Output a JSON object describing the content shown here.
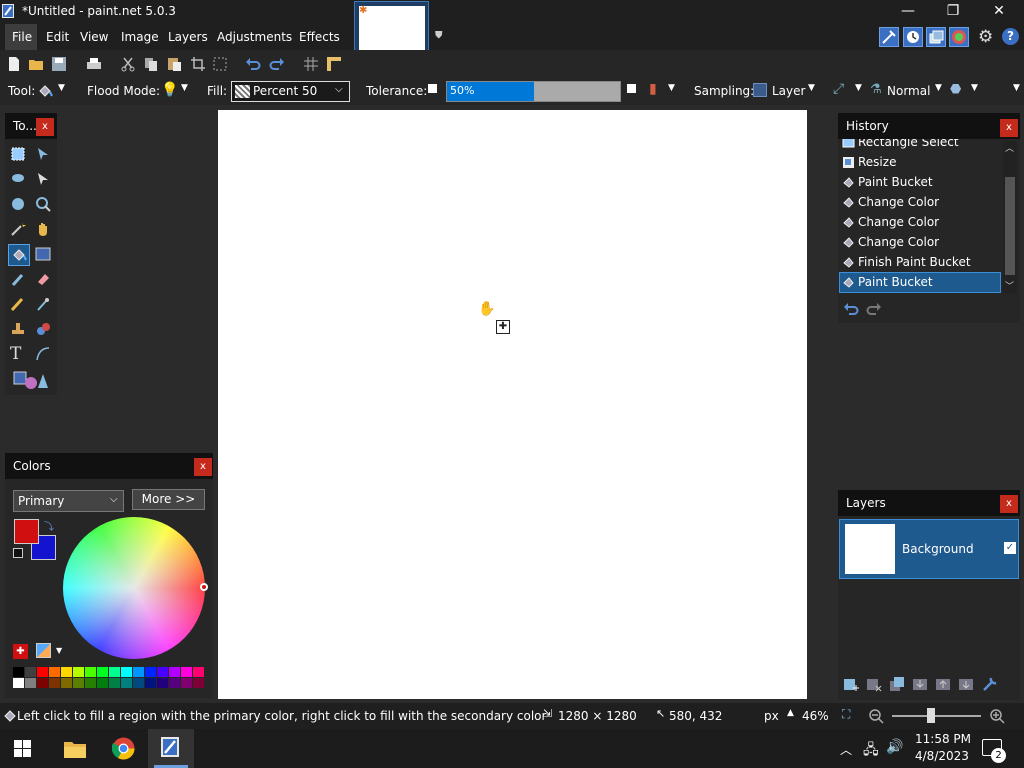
{
  "window": {
    "title": "*Untitled - paint.net 5.0.3",
    "minimize": "—",
    "restore": "❐",
    "close": "✕"
  },
  "menu": [
    "File",
    "Edit",
    "View",
    "Image",
    "Layers",
    "Adjustments",
    "Effects"
  ],
  "toolbar": {
    "tool_label": "Tool:",
    "flood_mode_label": "Flood Mode:",
    "fill_label": "Fill:",
    "fill_value": "Percent 50",
    "tolerance_label": "Tolerance:",
    "tolerance_value": "50%",
    "tolerance_fraction": 0.5,
    "sampling_label": "Sampling:",
    "sampling_value": "Layer",
    "blend_value": "Normal"
  },
  "tools_panel": {
    "title": "To...",
    "close": "x"
  },
  "colors_panel": {
    "title": "Colors",
    "close": "x",
    "mode": "Primary",
    "more_button": "More >>",
    "primary_color": "#d01010",
    "secondary_color": "#1414d0"
  },
  "history_panel": {
    "title": "History",
    "close": "x",
    "items": [
      "Rectangle Select",
      "Resize",
      "Paint Bucket",
      "Change Color",
      "Change Color",
      "Change Color",
      "Finish Paint Bucket",
      "Paint Bucket"
    ],
    "selected_index": 7
  },
  "layers_panel": {
    "title": "Layers",
    "close": "x",
    "layer_name": "Background"
  },
  "status": {
    "hint": "Left click to fill a region with the primary color, right click to fill with the secondary color",
    "image_size": "1280 × 1280",
    "cursor_pos": "580, 432",
    "units": "px",
    "zoom": "46%"
  },
  "taskbar": {
    "time": "11:58 PM",
    "date": "4/8/2023",
    "notifications": "2"
  },
  "colors": {
    "accent": "#0078d7",
    "selected_row": "#1f5a8f",
    "close_red": "#c42b1c"
  }
}
